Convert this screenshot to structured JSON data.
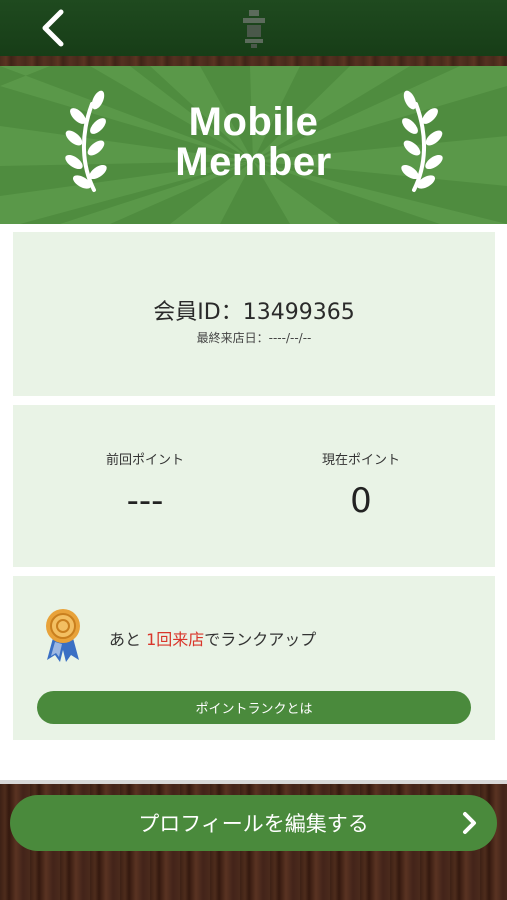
{
  "nav": {
    "back_icon": "chevron-left-icon",
    "logo_icon": "brand-logo-mark"
  },
  "banner": {
    "line1": "Mobile",
    "line2": "Member",
    "decoration_icon": "laurel-icon"
  },
  "member": {
    "id_text": "会員ID：13499365",
    "last_visit_text": "最終来店日：----/--/--"
  },
  "points": {
    "previous_label": "前回ポイント",
    "previous_value": "---",
    "current_label": "現在ポイント",
    "current_value": "0"
  },
  "rank": {
    "medal_icon": "bronze-medal-icon",
    "msg_prefix": "あと ",
    "msg_highlight": "1回来店",
    "msg_suffix": "でランクアップ",
    "button_label": "ポイントランクとは"
  },
  "footer": {
    "profile_button_label": "プロフィールを編集する",
    "chevron_icon": "chevron-right-icon"
  },
  "colors": {
    "primary_green": "#4a8a3c",
    "banner_green": "#4f8c3f",
    "nav_green": "#1f4a1f",
    "card_bg": "#e9f3e6",
    "highlight_red": "#d9362b"
  }
}
